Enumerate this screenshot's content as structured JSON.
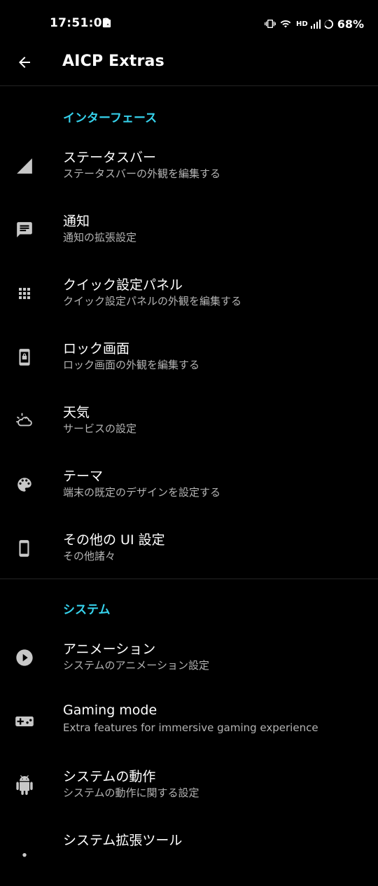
{
  "status_bar": {
    "time": "17:51:02",
    "network": "HD",
    "battery": "68%"
  },
  "app_bar": {
    "title": "AICP Extras"
  },
  "sections": [
    {
      "header": "インターフェース",
      "items": [
        {
          "icon": "signal-triangle-icon",
          "title": "ステータスバー",
          "summary": "ステータスバーの外観を編集する"
        },
        {
          "icon": "message-icon",
          "title": "通知",
          "summary": "通知の拡張設定"
        },
        {
          "icon": "apps-grid-icon",
          "title": "クイック設定パネル",
          "summary": "クイック設定パネルの外観を編集する"
        },
        {
          "icon": "lock-phone-icon",
          "title": "ロック画面",
          "summary": "ロック画面の外観を編集する"
        },
        {
          "icon": "weather-icon",
          "title": "天気",
          "summary": "サービスの設定"
        },
        {
          "icon": "palette-icon",
          "title": "テーマ",
          "summary": "端末の既定のデザインを設定する"
        },
        {
          "icon": "phone-icon",
          "title": "その他の UI 設定",
          "summary": "その他諸々"
        }
      ]
    },
    {
      "header": "システム",
      "items": [
        {
          "icon": "play-circle-icon",
          "title": "アニメーション",
          "summary": "システムのアニメーション設定"
        },
        {
          "icon": "gamepad-icon",
          "title": "Gaming mode",
          "summary": "Extra features for immersive gaming experience"
        },
        {
          "icon": "android-icon",
          "title": "システムの動作",
          "summary": "システムの動作に関する設定"
        },
        {
          "icon": "tools-icon",
          "title": "システム拡張ツール",
          "summary": ""
        }
      ]
    }
  ],
  "colors": {
    "accent": "#36d2ec",
    "background": "#000000",
    "summary_text": "#b4b4b4",
    "icon": "#c8c8c8"
  }
}
